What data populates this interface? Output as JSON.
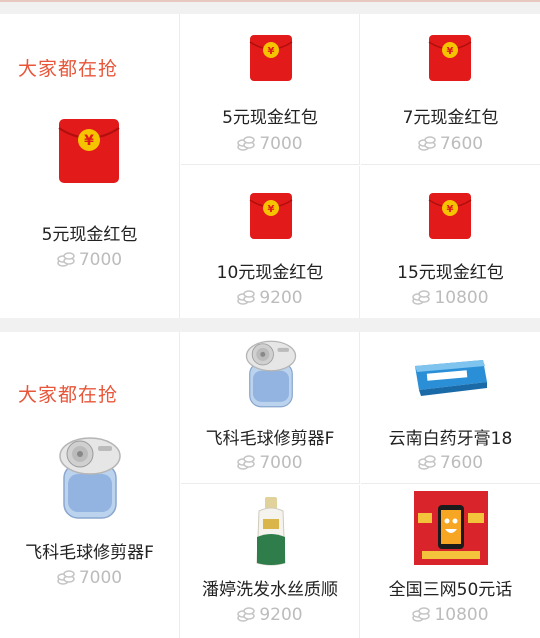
{
  "sections": [
    {
      "title": "大家都在抢",
      "feature": {
        "name": "5元现金红包",
        "price": "7000",
        "icon": "red-envelope-icon"
      },
      "items": [
        {
          "name": "5元现金红包",
          "price": "7000",
          "icon": "red-envelope-icon"
        },
        {
          "name": "7元现金红包",
          "price": "7600",
          "icon": "red-envelope-icon"
        },
        {
          "name": "10元现金红包",
          "price": "9200",
          "icon": "red-envelope-icon"
        },
        {
          "name": "15元现金红包",
          "price": "10800",
          "icon": "red-envelope-icon"
        }
      ]
    },
    {
      "title": "大家都在抢",
      "feature": {
        "name": "飞科毛球修剪器F",
        "price": "7000",
        "icon": "lint-remover-image"
      },
      "items": [
        {
          "name": "飞科毛球修剪器F",
          "price": "7000",
          "icon": "lint-remover-image"
        },
        {
          "name": "云南白药牙膏18",
          "price": "7600",
          "icon": "toothpaste-image"
        },
        {
          "name": "潘婷洗发水丝质顺",
          "price": "9200",
          "icon": "shampoo-bottle-image"
        },
        {
          "name": "全国三网50元话",
          "price": "10800",
          "icon": "phone-credit-card-image"
        }
      ]
    }
  ],
  "colors": {
    "accent": "#e8563a",
    "envelope_red": "#e21a1a",
    "coin_gold": "#f6c300",
    "price_gray": "#bcbcbc"
  }
}
